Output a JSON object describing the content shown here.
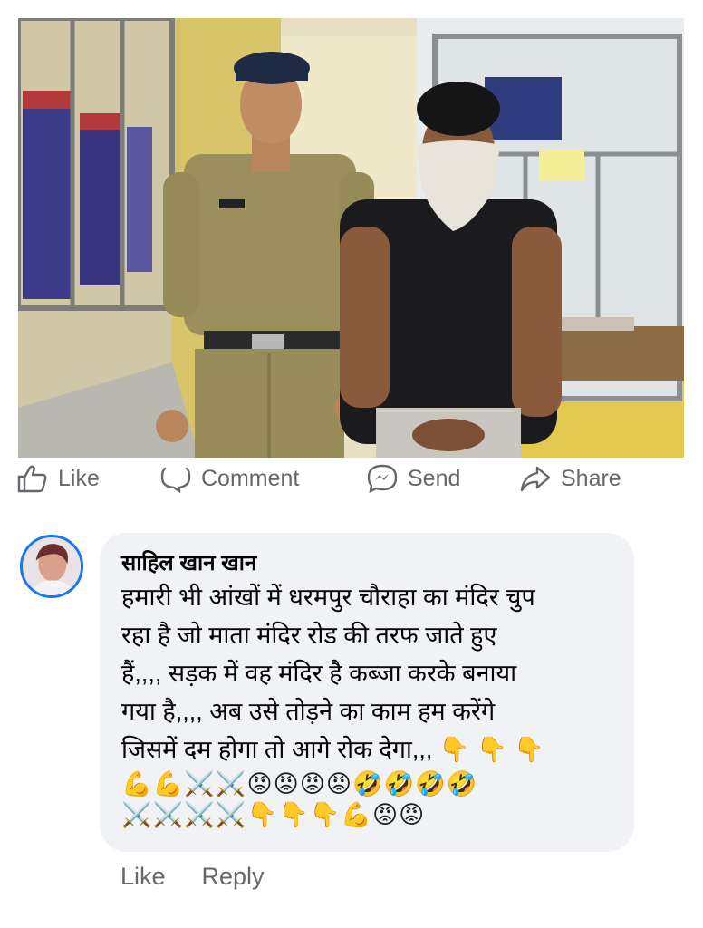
{
  "post": {
    "actions": {
      "like": "Like",
      "comment": "Comment",
      "send": "Send",
      "share": "Share"
    }
  },
  "comment": {
    "author": "साहिल खान खान",
    "text": "हमारी भी आंखों में धरमपुर चौराहा का मंदिर चुप\nरहा है जो माता मंदिर रोड की तरफ  जाते हुए\nहैं,,,,  सड़क में वह मंदिर है कब्जा करके बनाया\nगया है,,,, अब उसे तोड़ने का काम हम करेंगे\nजिसमें दम होगा तो आगे रोक देगा,,, 👇 👇 👇",
    "emoji_line_1": "💪💪⚔️⚔️😡😡😡😡🤣🤣🤣🤣",
    "emoji_line_2": "⚔️⚔️⚔️⚔️👇👇👇💪😡😡",
    "actions": {
      "like": "Like",
      "reply": "Reply"
    }
  },
  "colors": {
    "meta_text": "#65676b",
    "bubble_bg": "#f0f2f5",
    "avatar_ring": "#1877f2"
  }
}
